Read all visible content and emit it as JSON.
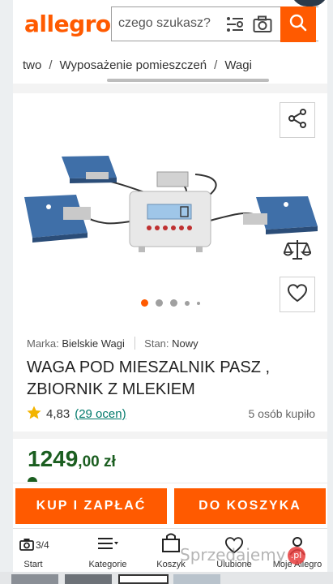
{
  "header": {
    "logo": "allegro",
    "search_placeholder": "czego szukasz?",
    "icons": [
      "filter-icon",
      "camera-icon",
      "search-icon"
    ],
    "brand_color": "#ff5a00"
  },
  "breadcrumb": {
    "items": [
      "two",
      "Wyposażenie pomieszczeń",
      "Wagi"
    ],
    "separator": "/"
  },
  "gallery": {
    "image": "livestock-scale-with-indicator",
    "image_count": 5,
    "active_image": 1,
    "actions": [
      "share-icon",
      "compare-icon",
      "heart-icon"
    ]
  },
  "product": {
    "brand_label": "Marka:",
    "brand": "Bielskie Wagi",
    "condition_label": "Stan:",
    "condition": "Nowy",
    "title": "WAGA POD MIESZALNIK PASZ , ZBIORNIK Z MLEKIEM",
    "rating": "4,83",
    "reviews": "(29 ocen)",
    "bought": "5 osób kupiło",
    "price_int": "1249",
    "price_dec": ",00 zł",
    "price_color": "#1b5e20",
    "rating_link_color": "#00796b"
  },
  "actions": {
    "buy_label": "KUP I ZAPŁAĆ",
    "cart_label": "DO KOSZYKA"
  },
  "nav": {
    "photo_counter": "3/4",
    "items": [
      {
        "label": "Start",
        "icon": "camera-icon"
      },
      {
        "label": "Kategorie",
        "icon": "menu-icon"
      },
      {
        "label": "Koszyk",
        "icon": "bag-icon"
      },
      {
        "label": "Ulubione",
        "icon": "heart-icon"
      },
      {
        "label": "Moje Allegro",
        "icon": "user-icon"
      }
    ]
  },
  "watermark": {
    "text": "Sprzedajemy",
    "badge": ".pl"
  }
}
